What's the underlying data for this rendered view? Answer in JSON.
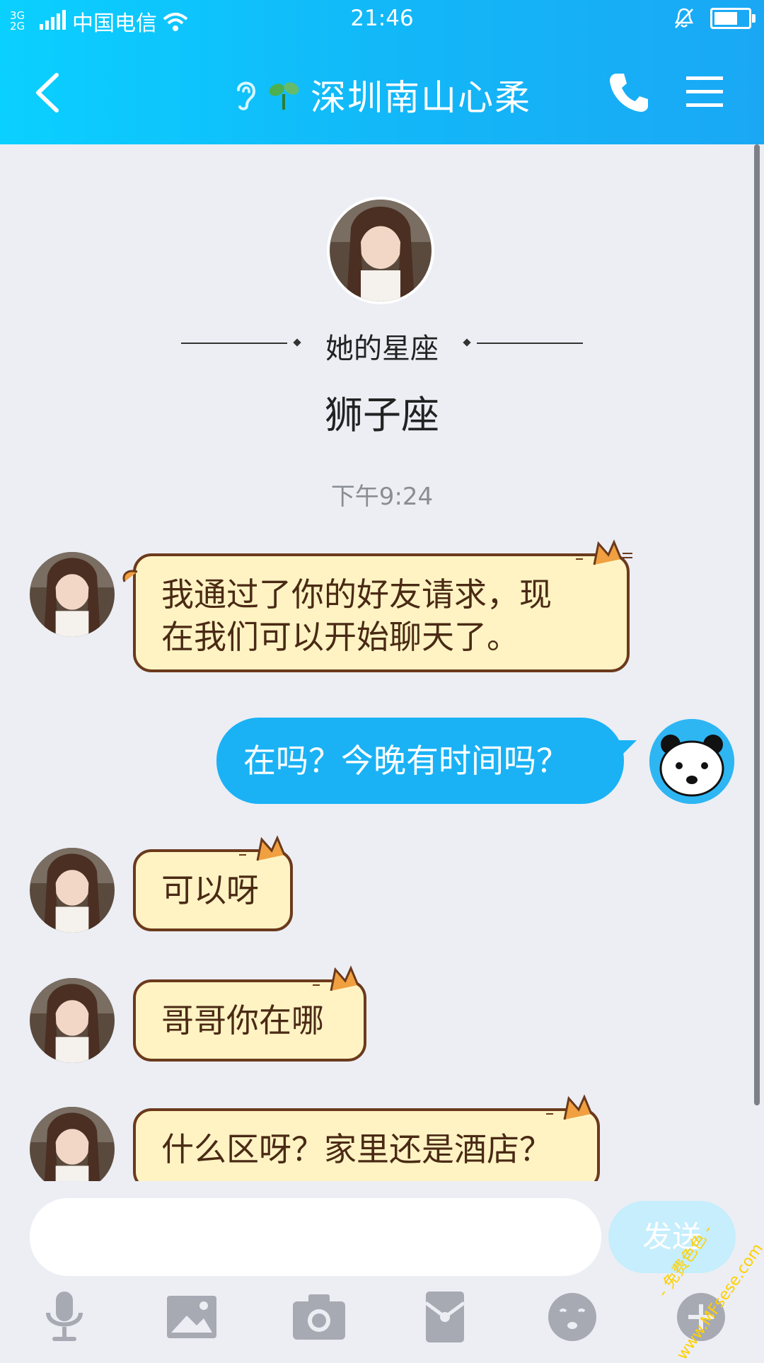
{
  "status_bar": {
    "network": "3G 2G",
    "carrier": "中国电信",
    "time": "21:46",
    "battery_level": 0.7
  },
  "header": {
    "title": "深圳南山心柔",
    "ear_icon": "ear-icon",
    "plant_icon": "sprout-icon"
  },
  "profile": {
    "zodiac_label": "她的星座",
    "zodiac_value": "狮子座"
  },
  "chat": {
    "timestamp": "下午9:24",
    "messages": [
      {
        "from": "other",
        "text_line1": "我通过了你的好友请求，现",
        "text_line2": "在我们可以开始聊天了。"
      },
      {
        "from": "me",
        "text": "在吗？今晚有时间吗？"
      },
      {
        "from": "other",
        "text": "可以呀"
      },
      {
        "from": "other",
        "text": "哥哥你在哪"
      },
      {
        "from": "other",
        "text": "什么区呀？家里还是酒店？"
      }
    ]
  },
  "input": {
    "placeholder": "",
    "send_label": "发送"
  },
  "toolbar": {
    "items": [
      "microphone-icon",
      "image-icon",
      "camera-icon",
      "red-packet-icon",
      "emoji-icon",
      "plus-icon"
    ]
  },
  "watermark": {
    "line1": "- 免费色色 -",
    "line2": "www.MFsese.com"
  },
  "colors": {
    "header": "#12b8f8",
    "bubble_out": "#1ab2f5",
    "bubble_in": "#fff3c4",
    "bubble_in_border": "#6b3a1c",
    "send_button": "#c6eefd"
  }
}
